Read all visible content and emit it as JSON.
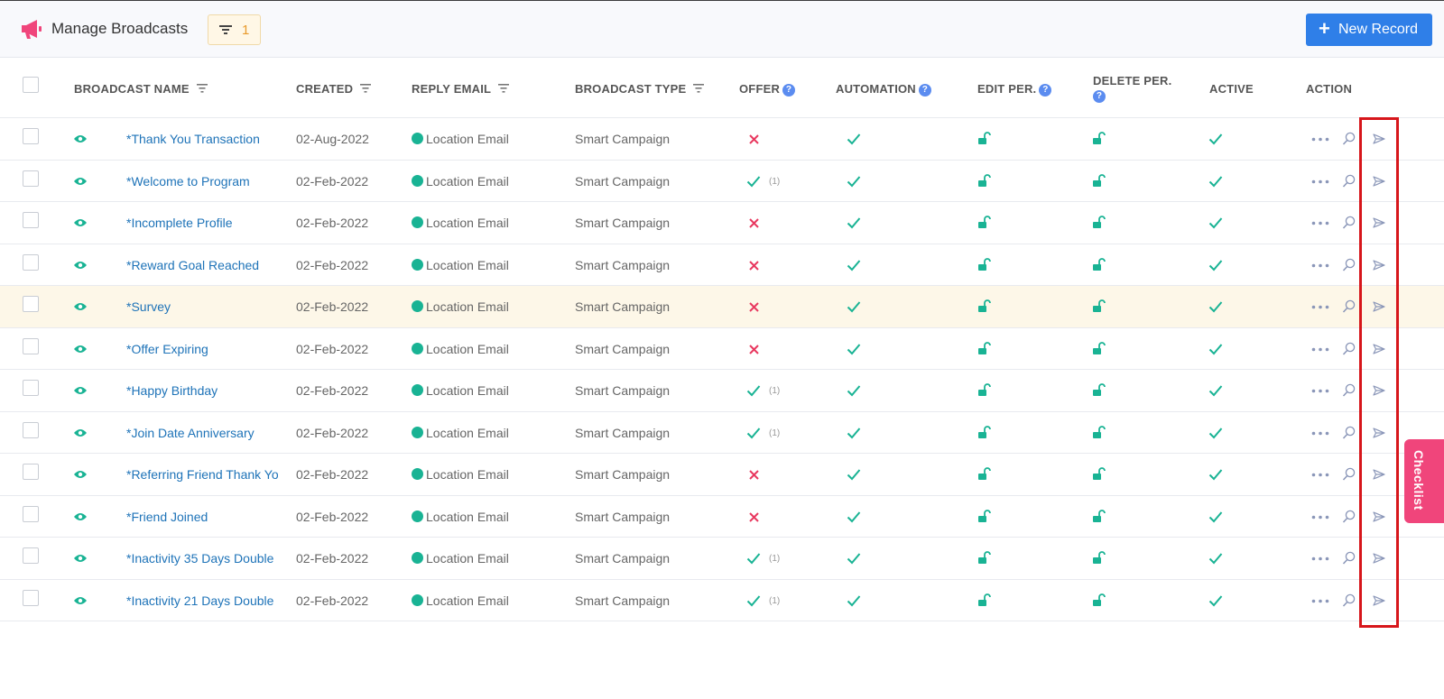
{
  "header": {
    "title": "Manage Broadcasts",
    "filter_count": "1",
    "new_record_label": "New Record"
  },
  "columns": {
    "name": "BROADCAST NAME",
    "created": "CREATED",
    "reply_email": "REPLY EMAIL",
    "type": "BROADCAST TYPE",
    "offer": "OFFER",
    "automation": "AUTOMATION",
    "edit_per": "EDIT PER.",
    "delete_per": "DELETE PER.",
    "active": "ACTIVE",
    "action": "ACTION"
  },
  "help_glyph": "?",
  "offer_count_label": "(1)",
  "rows": [
    {
      "name": "*Thank You Transaction",
      "created": "02-Aug-2022",
      "reply": "Location Email",
      "type": "Smart Campaign",
      "offer": false
    },
    {
      "name": "*Welcome to Program",
      "created": "02-Feb-2022",
      "reply": "Location Email",
      "type": "Smart Campaign",
      "offer": true
    },
    {
      "name": "*Incomplete Profile",
      "created": "02-Feb-2022",
      "reply": "Location Email",
      "type": "Smart Campaign",
      "offer": false
    },
    {
      "name": "*Reward Goal Reached",
      "created": "02-Feb-2022",
      "reply": "Location Email",
      "type": "Smart Campaign",
      "offer": false
    },
    {
      "name": "*Survey",
      "created": "02-Feb-2022",
      "reply": "Location Email",
      "type": "Smart Campaign",
      "offer": false
    },
    {
      "name": "*Offer Expiring",
      "created": "02-Feb-2022",
      "reply": "Location Email",
      "type": "Smart Campaign",
      "offer": false
    },
    {
      "name": "*Happy Birthday",
      "created": "02-Feb-2022",
      "reply": "Location Email",
      "type": "Smart Campaign",
      "offer": true
    },
    {
      "name": "*Join Date Anniversary",
      "created": "02-Feb-2022",
      "reply": "Location Email",
      "type": "Smart Campaign",
      "offer": true
    },
    {
      "name": "*Referring Friend Thank Yo",
      "created": "02-Feb-2022",
      "reply": "Location Email",
      "type": "Smart Campaign",
      "offer": false
    },
    {
      "name": "*Friend Joined",
      "created": "02-Feb-2022",
      "reply": "Location Email",
      "type": "Smart Campaign",
      "offer": false
    },
    {
      "name": "*Inactivity 35 Days Double",
      "created": "02-Feb-2022",
      "reply": "Location Email",
      "type": "Smart Campaign",
      "offer": true
    },
    {
      "name": "*Inactivity 21 Days Double",
      "created": "02-Feb-2022",
      "reply": "Location Email",
      "type": "Smart Campaign",
      "offer": true
    }
  ],
  "checklist_label": "Checklist",
  "colors": {
    "accent": "#2f7fe8",
    "teal": "#19b394",
    "red": "#e8385f",
    "link": "#1e73b8",
    "highlight_row": "#fdf7e8",
    "checklist": "#f0457b"
  }
}
